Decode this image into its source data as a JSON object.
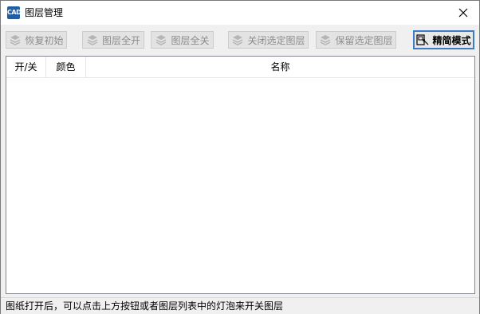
{
  "window": {
    "title": "图层管理",
    "app_icon_text": "CAD"
  },
  "toolbar": {
    "restore_label": "恢复初始",
    "all_on_label": "图层全开",
    "all_off_label": "图层全关",
    "close_selected_label": "关闭选定图层",
    "keep_selected_label": "保留选定图层",
    "simple_mode_label": "精简模式"
  },
  "table": {
    "columns": [
      "开/关",
      "颜色",
      "名称"
    ],
    "rows": []
  },
  "status": {
    "text": "图纸打开后，可以点击上方按钮或者图层列表中的灯泡来开关图层"
  },
  "colors": {
    "active_border": "#3d7bc4",
    "disabled_text": "#8c8c8c",
    "app_icon_bg": "#1f5fa8"
  }
}
